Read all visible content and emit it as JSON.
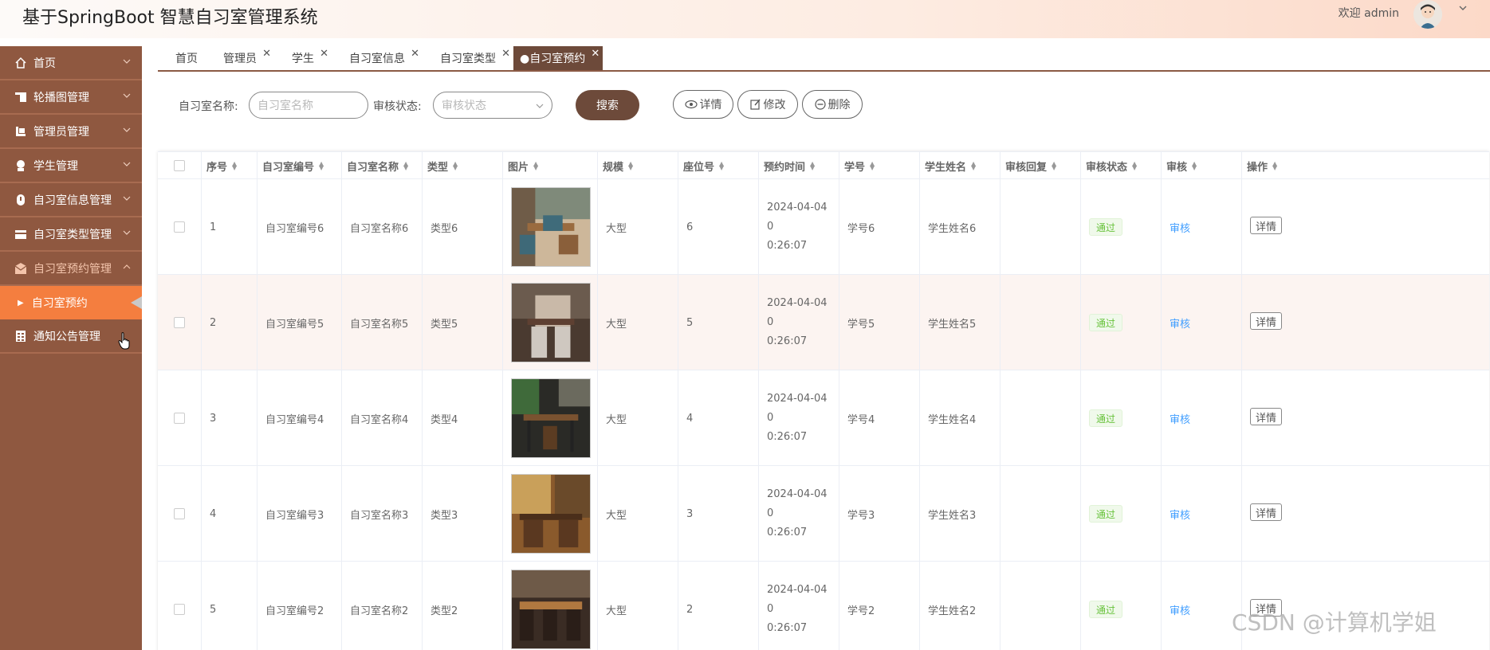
{
  "header": {
    "title": "基于SpringBoot 智慧自习室管理系统",
    "welcome": "欢迎 admin"
  },
  "sidebar": {
    "items": [
      {
        "label": "首页",
        "icon": "home-icon"
      },
      {
        "label": "轮播图管理",
        "icon": "carousel-icon"
      },
      {
        "label": "管理员管理",
        "icon": "admin-icon"
      },
      {
        "label": "学生管理",
        "icon": "student-icon"
      },
      {
        "label": "自习室信息管理",
        "icon": "info-icon"
      },
      {
        "label": "自习室类型管理",
        "icon": "type-icon"
      },
      {
        "label": "自习室预约管理",
        "icon": "reservation-icon"
      },
      {
        "label": "通知公告管理",
        "icon": "notice-icon"
      }
    ],
    "subitem": "自习室预约"
  },
  "tabs": [
    {
      "label": "首页"
    },
    {
      "label": "管理员"
    },
    {
      "label": "学生"
    },
    {
      "label": "自习室信息"
    },
    {
      "label": "自习室类型"
    },
    {
      "label": "●自习室预约"
    }
  ],
  "search": {
    "room_name_label": "自习室名称:",
    "room_name_placeholder": "自习室名称",
    "status_label": "审核状态:",
    "status_placeholder": "审核状态",
    "search_button": "搜索",
    "detail_button": "详情",
    "edit_button": "修改",
    "delete_button": "删除"
  },
  "table": {
    "headers": [
      "序号",
      "自习室编号",
      "自习室名称",
      "类型",
      "图片",
      "规模",
      "座位号",
      "预约时间",
      "学号",
      "学生姓名",
      "审核回复",
      "审核状态",
      "审核",
      "操作"
    ],
    "rows": [
      {
        "no": "1",
        "code": "自习室编号6",
        "name": "自习室名称6",
        "type": "类型6",
        "scale": "大型",
        "seat": "6",
        "time": "2024-04-04 0\n0:26:07",
        "sid": "学号6",
        "sname": "学生姓名6",
        "reply": "",
        "status": "通过",
        "audit": "审核",
        "op": "详情"
      },
      {
        "no": "2",
        "code": "自习室编号5",
        "name": "自习室名称5",
        "type": "类型5",
        "scale": "大型",
        "seat": "5",
        "time": "2024-04-04 0\n0:26:07",
        "sid": "学号5",
        "sname": "学生姓名5",
        "reply": "",
        "status": "通过",
        "audit": "审核",
        "op": "详情"
      },
      {
        "no": "3",
        "code": "自习室编号4",
        "name": "自习室名称4",
        "type": "类型4",
        "scale": "大型",
        "seat": "4",
        "time": "2024-04-04 0\n0:26:07",
        "sid": "学号4",
        "sname": "学生姓名4",
        "reply": "",
        "status": "通过",
        "audit": "审核",
        "op": "详情"
      },
      {
        "no": "4",
        "code": "自习室编号3",
        "name": "自习室名称3",
        "type": "类型3",
        "scale": "大型",
        "seat": "3",
        "time": "2024-04-04 0\n0:26:07",
        "sid": "学号3",
        "sname": "学生姓名3",
        "reply": "",
        "status": "通过",
        "audit": "审核",
        "op": "详情"
      },
      {
        "no": "5",
        "code": "自习室编号2",
        "name": "自习室名称2",
        "type": "类型2",
        "scale": "大型",
        "seat": "2",
        "time": "2024-04-04 0\n0:26:07",
        "sid": "学号2",
        "sname": "学生姓名2",
        "reply": "",
        "status": "通过",
        "audit": "审核",
        "op": "详情"
      }
    ]
  },
  "watermark": "CSDN @计算机学姐",
  "colors": {
    "sidebar_bg": "#8f5840",
    "accent": "#6d4a3a",
    "submenu_active": "#f47e3f",
    "status_green": "#67c23a",
    "link_blue": "#409eff"
  }
}
